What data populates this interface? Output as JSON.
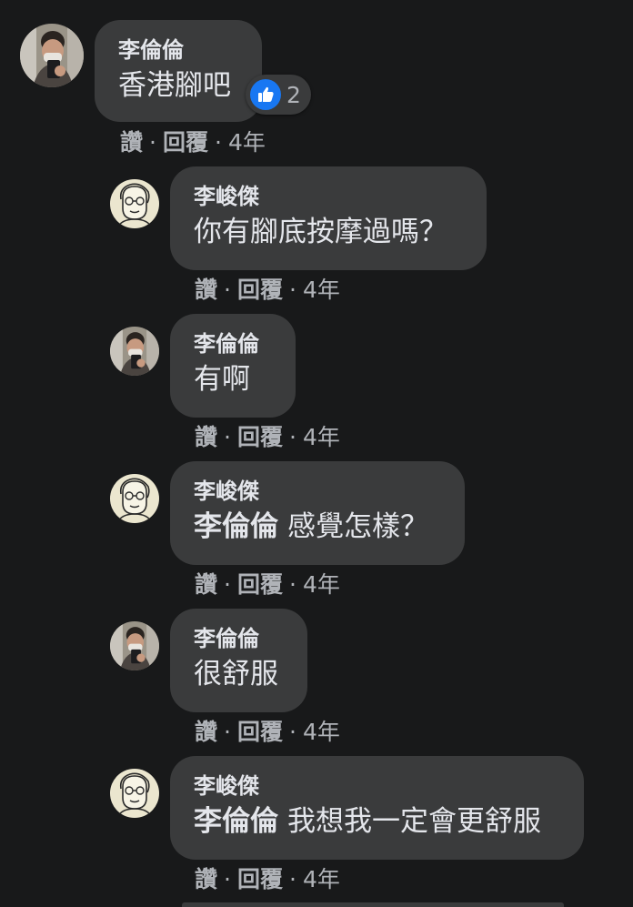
{
  "comments": [
    {
      "author": "李倫倫",
      "mention": "",
      "text": "香港腳吧",
      "actions": {
        "like": "讚",
        "reply": "回覆",
        "time": "4年"
      },
      "reaction": {
        "icon": "thumbs-up-icon",
        "count": "2"
      }
    },
    {
      "author": "李峻傑",
      "mention": "",
      "text": "你有腳底按摩過嗎？",
      "actions": {
        "like": "讚",
        "reply": "回覆",
        "time": "4年"
      }
    },
    {
      "author": "李倫倫",
      "mention": "",
      "text": "有啊",
      "actions": {
        "like": "讚",
        "reply": "回覆",
        "time": "4年"
      }
    },
    {
      "author": "李峻傑",
      "mention": "李倫倫",
      "text": "感覺怎樣？",
      "actions": {
        "like": "讚",
        "reply": "回覆",
        "time": "4年"
      }
    },
    {
      "author": "李倫倫",
      "mention": "",
      "text": "很舒服",
      "actions": {
        "like": "讚",
        "reply": "回覆",
        "time": "4年"
      }
    },
    {
      "author": "李峻傑",
      "mention": "李倫倫",
      "text": "我想我一定會更舒服",
      "actions": {
        "like": "讚",
        "reply": "回覆",
        "time": "4年"
      }
    }
  ],
  "colors": {
    "background": "#18191a",
    "bubble": "#3a3b3c",
    "primary_text": "#e4e6eb",
    "secondary_text": "#b0b3b8",
    "like_blue": "#1877f2"
  }
}
